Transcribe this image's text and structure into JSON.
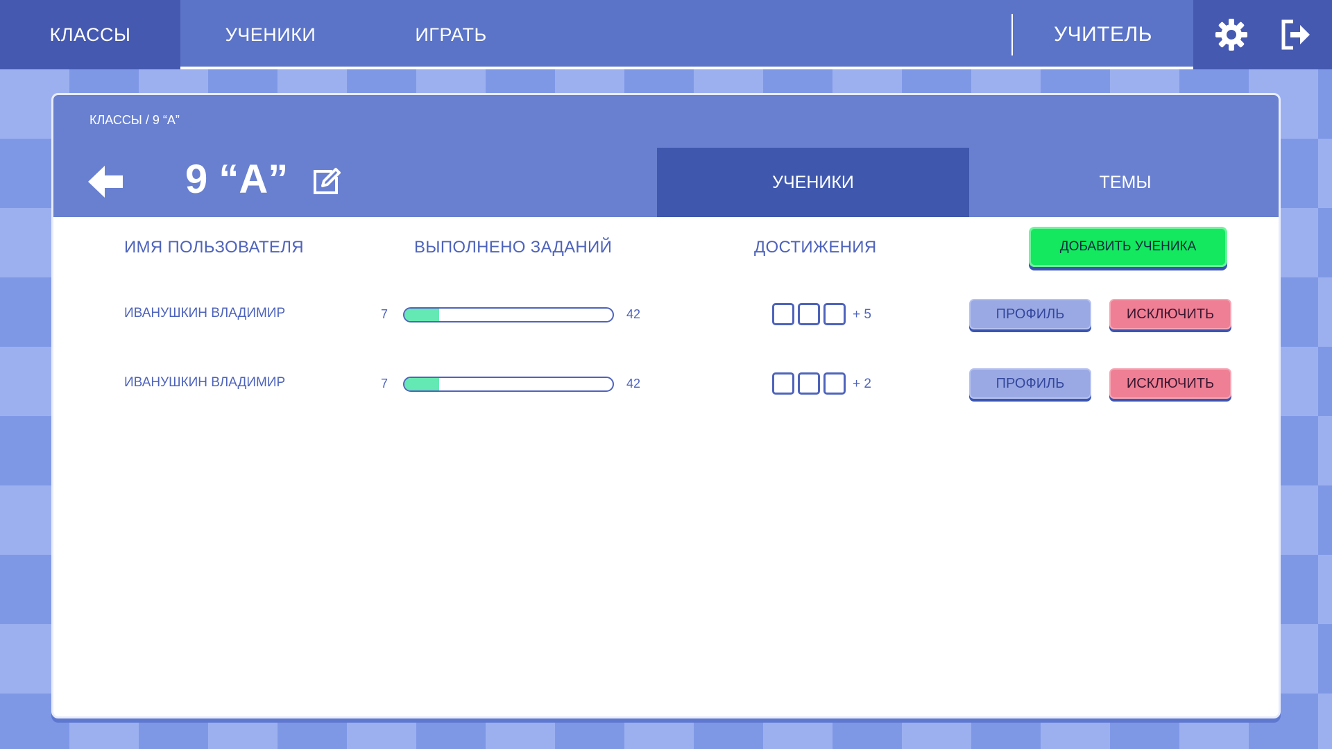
{
  "nav": {
    "classes": "КЛАССЫ",
    "students": "УЧЕНИКИ",
    "play": "ИГРАТЬ",
    "user_role": "УЧИТЕЛЬ"
  },
  "breadcrumb": "КЛАССЫ / 9 “А”",
  "class_title": "9 “А”",
  "tabs": {
    "students": "УЧЕНИКИ",
    "topics": "ТЕМЫ"
  },
  "table": {
    "headers": {
      "username": "ИМЯ ПОЛЬЗОВАТЕЛЯ",
      "completed": "ВЫПОЛНЕНО ЗАДАНИЙ",
      "achievements": "ДОСТИЖЕНИЯ"
    },
    "add_button": "ДОБАВИТЬ УЧЕНИКА",
    "rows": [
      {
        "name": "ИВАНУШКИН ВЛАДИМИР",
        "done": "7",
        "total": "42",
        "progress": 0.167,
        "achievements_more": "+ 5",
        "profile_label": "ПРОФИЛЬ",
        "exclude_label": "ИСКЛЮЧИТЬ"
      },
      {
        "name": "ИВАНУШКИН ВЛАДИМИР",
        "done": "7",
        "total": "42",
        "progress": 0.167,
        "achievements_more": "+ 2",
        "profile_label": "ПРОФИЛЬ",
        "exclude_label": "ИСКЛЮЧИТЬ"
      }
    ]
  },
  "icons": {
    "settings": "gear-icon",
    "logout": "logout-icon",
    "back": "arrow-left-icon",
    "edit": "edit-icon"
  },
  "colors": {
    "nav_bg": "#5b74c8",
    "nav_active": "#4659b0",
    "header_bg": "#6980d0",
    "tab_active": "#3f58ad",
    "text_accent": "#4e63bb",
    "add_button": "#13e85f",
    "profile_button": "#9aa9e4",
    "exclude_button": "#ef7f94",
    "progress_fill": "#64e8b4"
  }
}
